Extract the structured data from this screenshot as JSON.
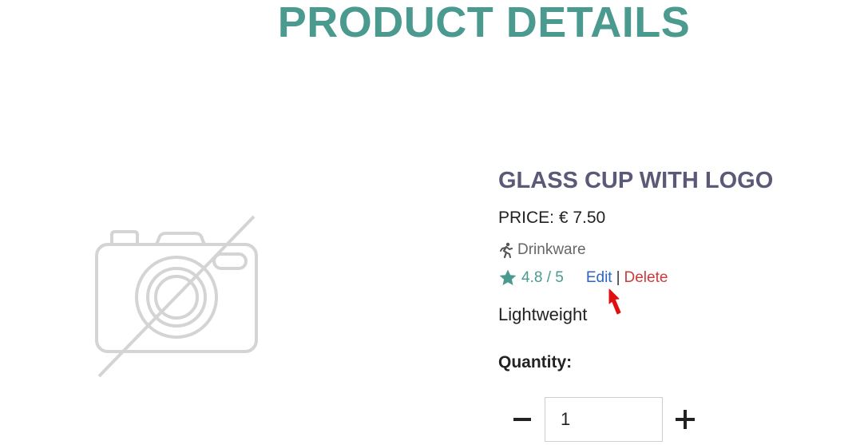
{
  "page": {
    "title": "PRODUCT DETAILS"
  },
  "product": {
    "name": "GLASS CUP WITH LOGO",
    "price": "PRICE: € 7.50",
    "category": "Drinkware",
    "category_icon": "running-person-icon",
    "rating": "4.8 / 5",
    "rating_icon": "star-icon",
    "description": "Lightweight",
    "image_icon": "no-image-camera-icon"
  },
  "actions": {
    "edit_label": "Edit",
    "separator": "|",
    "delete_label": "Delete"
  },
  "quantity": {
    "label": "Quantity:",
    "value": "1",
    "decrement_icon": "minus-icon",
    "increment_icon": "plus-icon"
  },
  "colors": {
    "accent": "#4a9a8f",
    "product_name": "#5a5a78",
    "edit_link": "#2b66c4",
    "delete_link": "#cc3a3a",
    "cursor": "#e01010"
  }
}
